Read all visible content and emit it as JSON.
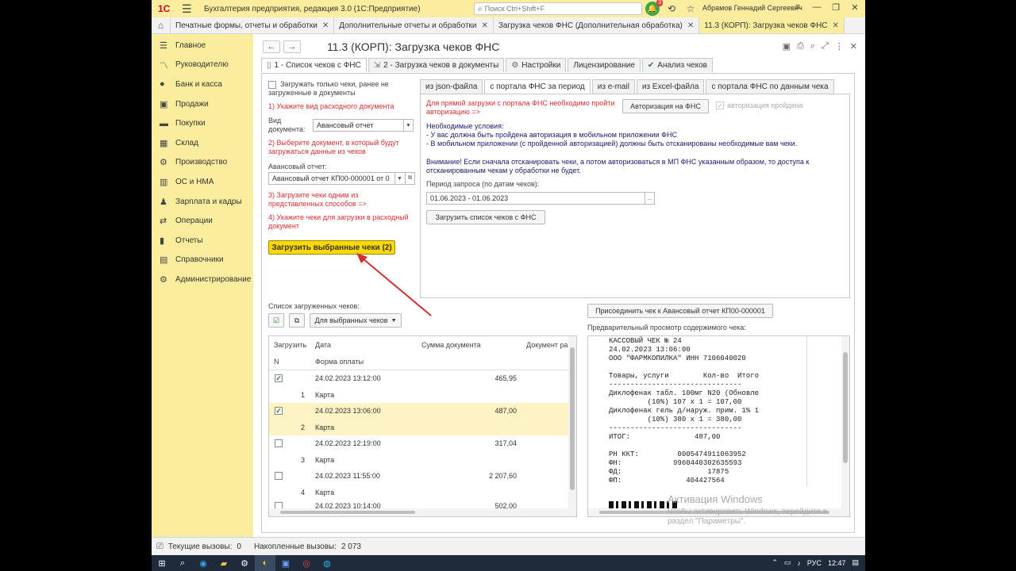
{
  "app": {
    "logo": "1С",
    "title": "Бухгалтерия предприятия, редакция 3.0  (1С:Предприятие)",
    "search_placeholder": "Поиск Ctrl+Shift+F",
    "notifications_count": "3",
    "user": "Абрамов Геннадий Сергеевич"
  },
  "window_tabs": [
    {
      "label": "Печатные формы, отчеты и обработки",
      "active": false
    },
    {
      "label": "Дополнительные отчеты и обработки",
      "active": false
    },
    {
      "label": "Загрузка чеков ФНС (Дополнительная обработка)",
      "active": false
    },
    {
      "label": "11.3 (КОРП): Загрузка чеков ФНС",
      "active": true
    }
  ],
  "sidebar": {
    "items": [
      {
        "label": "Главное",
        "icon": "menu-icon"
      },
      {
        "label": "Руководителю",
        "icon": "chart-line-icon"
      },
      {
        "label": "Банк и касса",
        "icon": "bank-icon"
      },
      {
        "label": "Продажи",
        "icon": "cart-icon"
      },
      {
        "label": "Покупки",
        "icon": "truck-icon"
      },
      {
        "label": "Склад",
        "icon": "warehouse-icon"
      },
      {
        "label": "Производство",
        "icon": "gear-icon"
      },
      {
        "label": "ОС и НМА",
        "icon": "building-icon"
      },
      {
        "label": "Зарплата и кадры",
        "icon": "person-icon"
      },
      {
        "label": "Операции",
        "icon": "operations-icon"
      },
      {
        "label": "Отчеты",
        "icon": "bar-chart-icon"
      },
      {
        "label": "Справочники",
        "icon": "book-icon"
      },
      {
        "label": "Администрирование",
        "icon": "gear-icon"
      }
    ]
  },
  "form": {
    "title": "11.3 (КОРП): Загрузка чеков ФНС",
    "tabs": [
      "1 - Список чеков с ФНС",
      "2 - Загрузка чеков в документы",
      "Настройки",
      "Лицензирование",
      "Анализ чеков"
    ]
  },
  "left": {
    "only_unloaded": "Загружать только чеки, ранее не загруженные в документы",
    "step1": "1) Укажите вид расходного документа",
    "doc_type_label": "Вид документа:",
    "doc_type_value": "Авансовый отчет",
    "step2": "2) Выберите документ, в который будут загружаться данные из чеков",
    "advance_label": "Авансовый отчет:",
    "advance_value": "Авансовый отчет КП00-000001 от 0",
    "step3": "3) Загрузите чеки одним из представленных способов =>",
    "step4": "4) Укажите чеки для загрузки в расходный документ",
    "load_selected_btn": "Загрузить выбранные чеки (2)"
  },
  "right": {
    "tabs": [
      "из json-файла",
      "с портала ФНС за период",
      "из e-mail",
      "из Excel-файла",
      "с портала ФНС по данным чека"
    ],
    "auth_hint": "Для прямой загрузки с портала ФНС необходимо пройти авторизацию =>",
    "auth_btn": "Авторизация на ФНС",
    "auth_done": "авторизация пройдена",
    "conditions_title": "Необходимые условия:",
    "cond1": "- У вас должна быть пройдена авторизация в мобильном приложении ФНС",
    "cond2": "- В мобильном приложении (с пройденной авторизацией) должны быть отсканированы необходимые вам чеки.",
    "warning": "Внимание! Если сначала отсканировать чеки, а потом авторизоваться в МП ФНС указанным образом, то доступа к отсканированным чекам у обработки не будет.",
    "period_label": "Период запроса (по датам чеков):",
    "period_value": "01.06.2023 - 01.06.2023",
    "load_list_btn": "Загрузить список чеков с ФНС"
  },
  "list": {
    "title": "Список загруженных чеков:",
    "for_selected": "Для выбранных чеков",
    "headers": {
      "load": "Загрузить",
      "date": "Дата",
      "sum": "Сумма документа",
      "doc": "Документ ра",
      "n": "N",
      "payment": "Форма оплаты"
    },
    "rows": [
      {
        "checked": true,
        "date": "24.02.2023 13:12:00",
        "sum": "465,95",
        "n": "1",
        "payment": "Карта",
        "selected": false
      },
      {
        "checked": true,
        "date": "24.02.2023 13:06:00",
        "sum": "487,00",
        "n": "2",
        "payment": "Карта",
        "selected": true
      },
      {
        "checked": false,
        "date": "24.02.2023 12:19:00",
        "sum": "317,04",
        "n": "3",
        "payment": "Карта",
        "selected": false
      },
      {
        "checked": false,
        "date": "24.02.2023 11:55:00",
        "sum": "2 207,60",
        "n": "4",
        "payment": "Карта",
        "selected": false
      },
      {
        "checked": false,
        "date": "24.02.2023 10:14:00",
        "sum": "502,00",
        "n": "",
        "payment": "",
        "selected": false
      }
    ]
  },
  "preview": {
    "attach_btn": "Присоединить чек к Авансовый отчет КП00-000001",
    "label": "Предварительный просмотр содержимого чека:",
    "lines": [
      "КАССОВЫЙ ЧЕК № 24",
      "24.02.2023 13:06:00",
      "ООО \"ФАРМКОПИЛКА\" ИНН 7106040020",
      "",
      "Товары, услуги        Кол-во  Итого",
      "-------------------------------",
      "Диклофенак табл. 100мг N20 (Обновле",
      "         (10%) 107 x 1 = 107,00",
      "Диклофенак гель д/наруж. прим. 1% 1",
      "         (10%) 380 x 1 = 380,00",
      "-------------------------------",
      "ИТОГ:               487,00",
      "",
      "РН ККТ:         0005474911063952",
      "ФН:            9960440302635593",
      "ФД:                    17875",
      "ФП:               404427564"
    ],
    "watermark_title": "Активация Windows",
    "watermark_sub": "Чтобы активировать Windows, перейдите в раздел \"Параметры\"."
  },
  "status": {
    "current": "Текущие вызовы:",
    "current_val": "0",
    "accumulated": "Накопленные вызовы:",
    "accumulated_val": "2 073"
  },
  "taskbar": {
    "lang": "РУС",
    "time": "12:47"
  }
}
